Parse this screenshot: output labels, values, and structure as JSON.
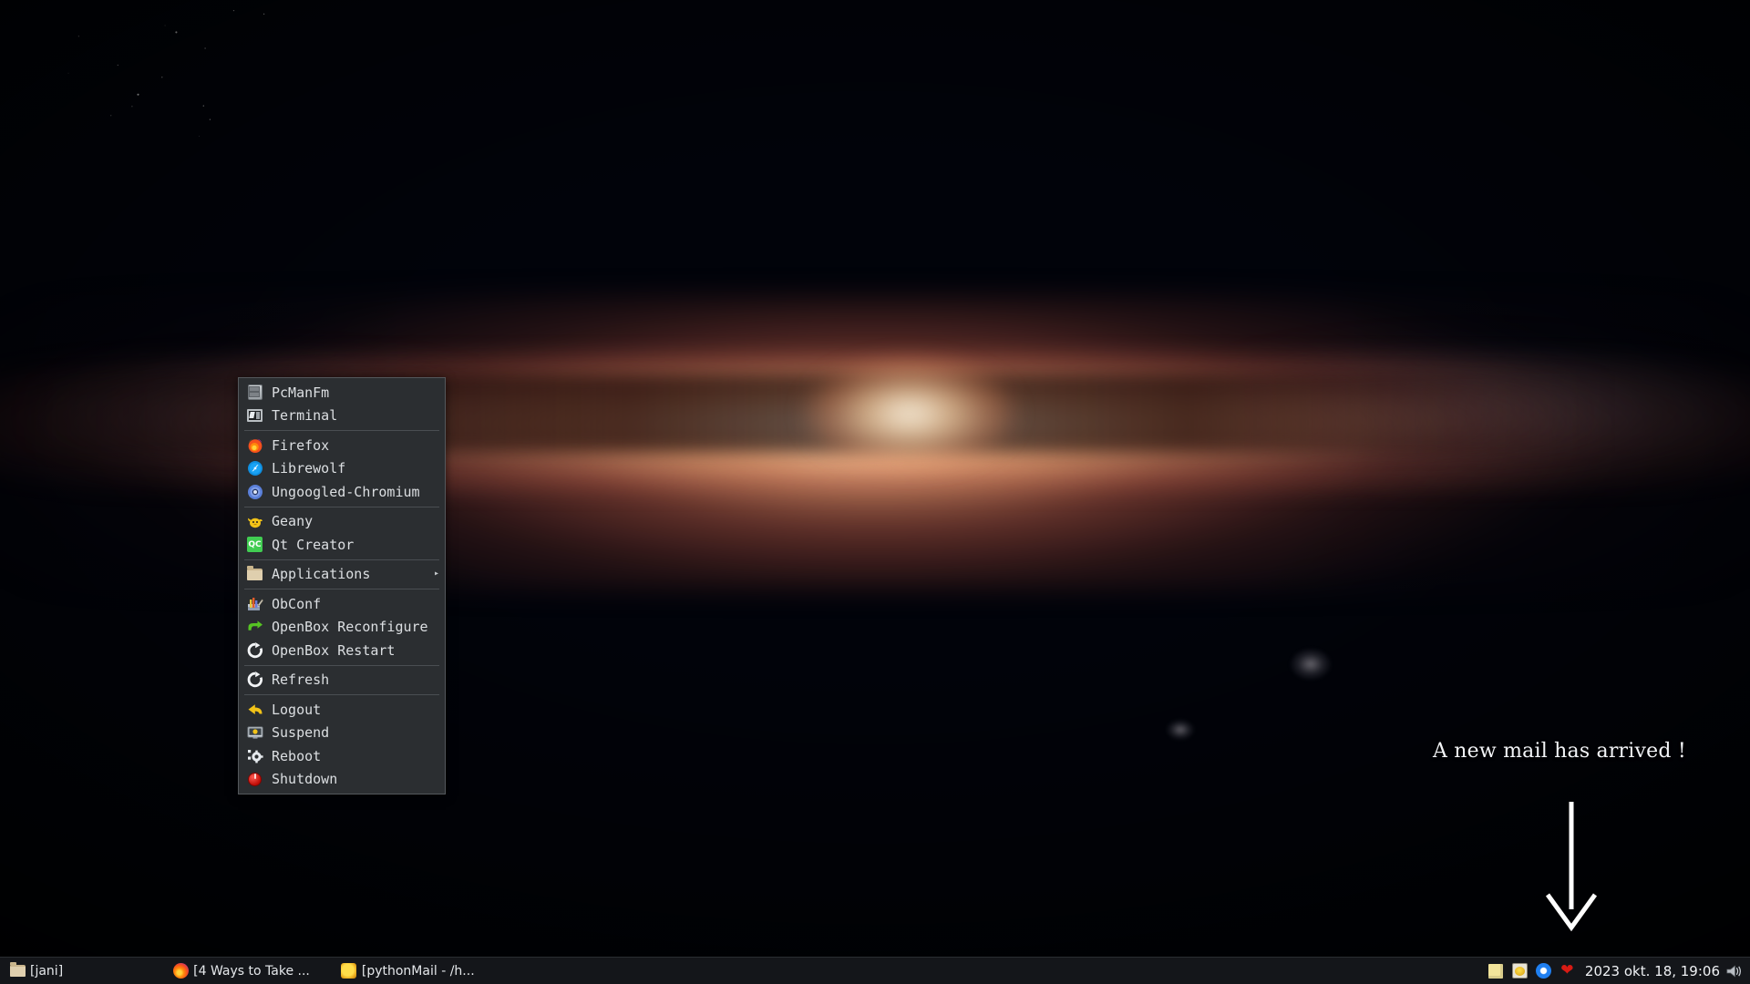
{
  "desktop": {
    "wallpaper_description": "milky-way-galaxy-night-sky",
    "background_color": "#01030a"
  },
  "root_menu": {
    "name": "openbox-root-menu",
    "background_color": "#2b2e31",
    "text_color": "#dcdfe2",
    "groups": [
      {
        "items": [
          {
            "label": "PcManFm",
            "icon": "file-manager-icon",
            "submenu": false
          },
          {
            "label": "Terminal",
            "icon": "terminal-icon",
            "submenu": false
          }
        ]
      },
      {
        "items": [
          {
            "label": "Firefox",
            "icon": "firefox-icon",
            "submenu": false
          },
          {
            "label": "Librewolf",
            "icon": "librewolf-icon",
            "submenu": false
          },
          {
            "label": "Ungoogled-Chromium",
            "icon": "chromium-icon",
            "submenu": false
          }
        ]
      },
      {
        "items": [
          {
            "label": "Geany",
            "icon": "geany-icon",
            "submenu": false
          },
          {
            "label": "Qt Creator",
            "icon": "qt-creator-icon",
            "submenu": false
          }
        ]
      },
      {
        "items": [
          {
            "label": "Applications",
            "icon": "folder-icon",
            "submenu": true,
            "submenu_arrow": "▸"
          }
        ]
      },
      {
        "items": [
          {
            "label": "ObConf",
            "icon": "obconf-icon",
            "submenu": false
          },
          {
            "label": "OpenBox Reconfigure",
            "icon": "reconfigure-arrow-icon",
            "submenu": false
          },
          {
            "label": "OpenBox Restart",
            "icon": "restart-icon",
            "submenu": false
          }
        ]
      },
      {
        "items": [
          {
            "label": "Refresh",
            "icon": "refresh-icon",
            "submenu": false
          }
        ]
      },
      {
        "items": [
          {
            "label": "Logout",
            "icon": "logout-arrow-icon",
            "submenu": false
          },
          {
            "label": "Suspend",
            "icon": "suspend-monitor-icon",
            "submenu": false
          },
          {
            "label": "Reboot",
            "icon": "reboot-gear-icon",
            "submenu": false
          },
          {
            "label": "Shutdown",
            "icon": "shutdown-icon",
            "submenu": false
          }
        ]
      }
    ]
  },
  "notification": {
    "text": "A new mail has arrived !",
    "arrow": "down-arrow-annotation",
    "color": "#f2f4f7"
  },
  "taskbar": {
    "background_color": "#14161a",
    "tasks": [
      {
        "label": "[jani]",
        "icon": "folder-icon"
      },
      {
        "label": "[4 Ways to Take ...",
        "icon": "firefox-icon"
      },
      {
        "label": "[pythonMail - /h...",
        "icon": "geany-icon"
      }
    ],
    "tray": [
      {
        "name": "sticky-note-icon"
      },
      {
        "name": "clipboard-icon"
      },
      {
        "name": "blue-dot-icon"
      },
      {
        "name": "heart-icon"
      }
    ],
    "clock": "2023 okt. 18, 19:06",
    "volume_icon": "speaker-icon"
  }
}
